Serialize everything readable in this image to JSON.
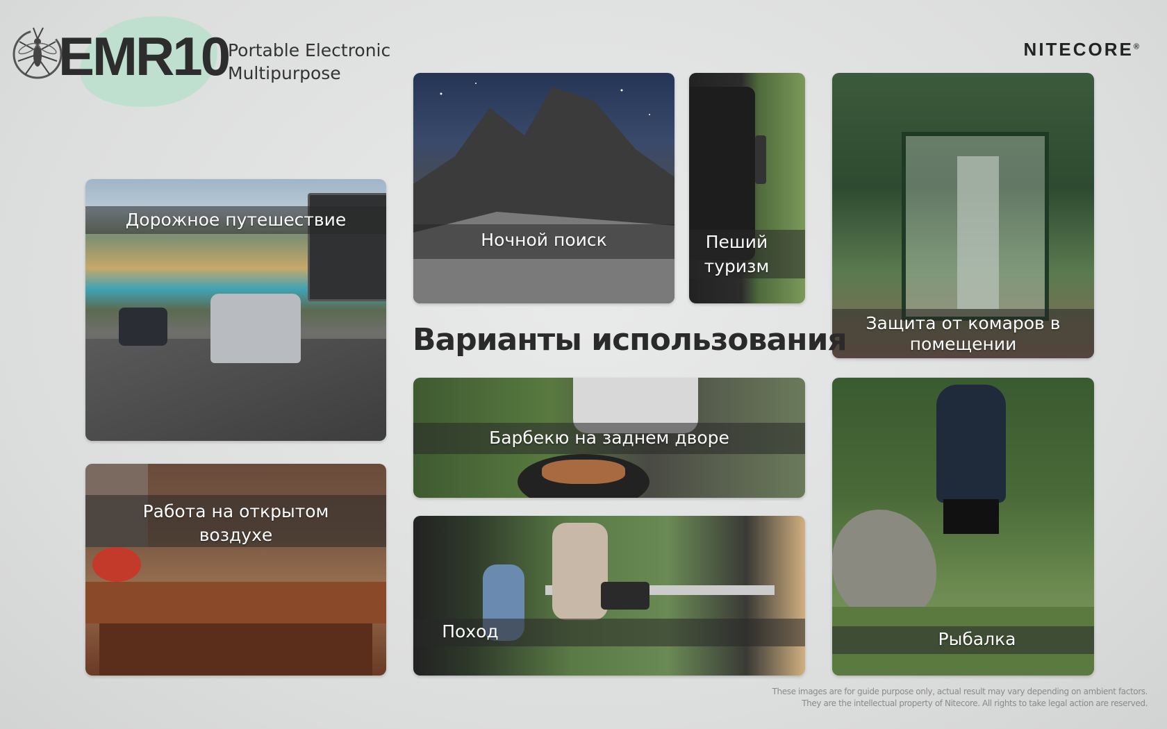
{
  "brand": {
    "model": "EMR10",
    "tagline_line1": "Portable Electronic",
    "tagline_line2": "Multipurpose",
    "company": "NITECORE",
    "registered": "®"
  },
  "heading": "Варианты использования",
  "tiles": {
    "road_trip": "Дорожное путешествие",
    "night_search": "Ночной поиск",
    "hiking_line1": "Пеший",
    "hiking_line2": "туризм",
    "indoor_line1": "Защита от комаров в",
    "indoor_line2": "помещении",
    "bbq": "Барбекю на заднем дворе",
    "outdoor_work_line1": "Работа на открытом",
    "outdoor_work_line2": "воздухе",
    "camping": "Поход",
    "fishing": "Рыбалка"
  },
  "disclaimer": {
    "line1": "These images are for guide purpose only, actual result may vary depending on ambient factors.",
    "line2": "They are the intellectual property of Nitecore. All rights to take legal action are reserved."
  },
  "colors": {
    "logo_blob": "#bfe0cf",
    "text_dark": "#2a2a2a"
  }
}
